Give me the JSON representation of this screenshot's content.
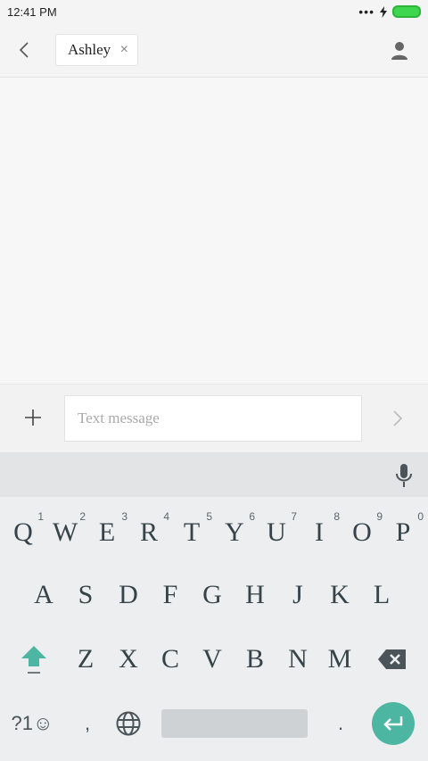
{
  "status": {
    "time": "12:41 PM"
  },
  "header": {
    "recipient_name": "Ashley",
    "chip_close": "×"
  },
  "compose": {
    "placeholder": "Text message"
  },
  "keyboard": {
    "row1": [
      {
        "label": "Q",
        "hint": "1"
      },
      {
        "label": "W",
        "hint": "2"
      },
      {
        "label": "E",
        "hint": "3"
      },
      {
        "label": "R",
        "hint": "4"
      },
      {
        "label": "T",
        "hint": "5"
      },
      {
        "label": "Y",
        "hint": "6"
      },
      {
        "label": "U",
        "hint": "7"
      },
      {
        "label": "I",
        "hint": "8"
      },
      {
        "label": "O",
        "hint": "9"
      },
      {
        "label": "P",
        "hint": "0"
      }
    ],
    "row2": [
      "A",
      "S",
      "D",
      "F",
      "G",
      "H",
      "J",
      "K",
      "L"
    ],
    "row3": [
      "Z",
      "X",
      "C",
      "V",
      "B",
      "N",
      "M"
    ],
    "symbols_label": "?1☺",
    "comma_label": ",",
    "period_label": "."
  },
  "colors": {
    "accent": "#4cb6a2",
    "battery": "#3fd64f"
  }
}
